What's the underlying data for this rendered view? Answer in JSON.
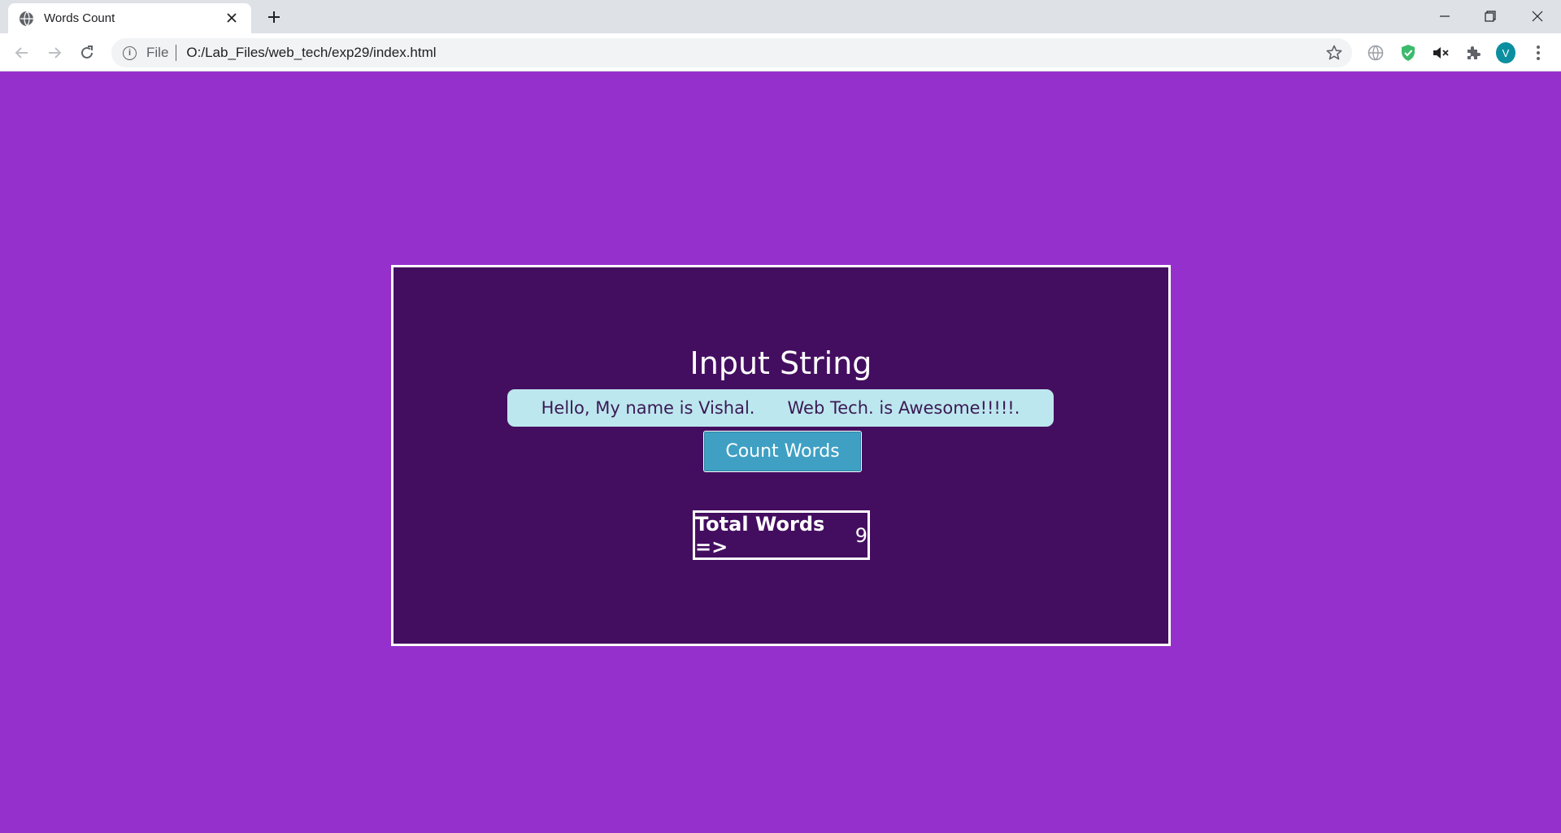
{
  "browser": {
    "tab_title": "Words Count",
    "scheme_label": "File",
    "url": "O:/Lab_Files/web_tech/exp29/index.html",
    "avatar_letter": "V",
    "icons": [
      "globe-icon",
      "back-icon",
      "forward-icon",
      "reload-icon",
      "info-icon",
      "star-icon",
      "extension-globe-icon",
      "shield-check-icon",
      "mute-icon",
      "puzzle-icon",
      "kebab-menu-icon"
    ]
  },
  "page": {
    "heading": "Input String",
    "input_value": "Hello, My name is Vishal.      Web Tech. is Awesome!!!!!.",
    "button_label": "Count Words",
    "result_label": "Total Words =>",
    "result_value": "9"
  },
  "colors": {
    "page_background": "#9530cd",
    "card_background": "#440e60",
    "input_background": "#bde7ee",
    "button_background": "#3fa0c4"
  }
}
